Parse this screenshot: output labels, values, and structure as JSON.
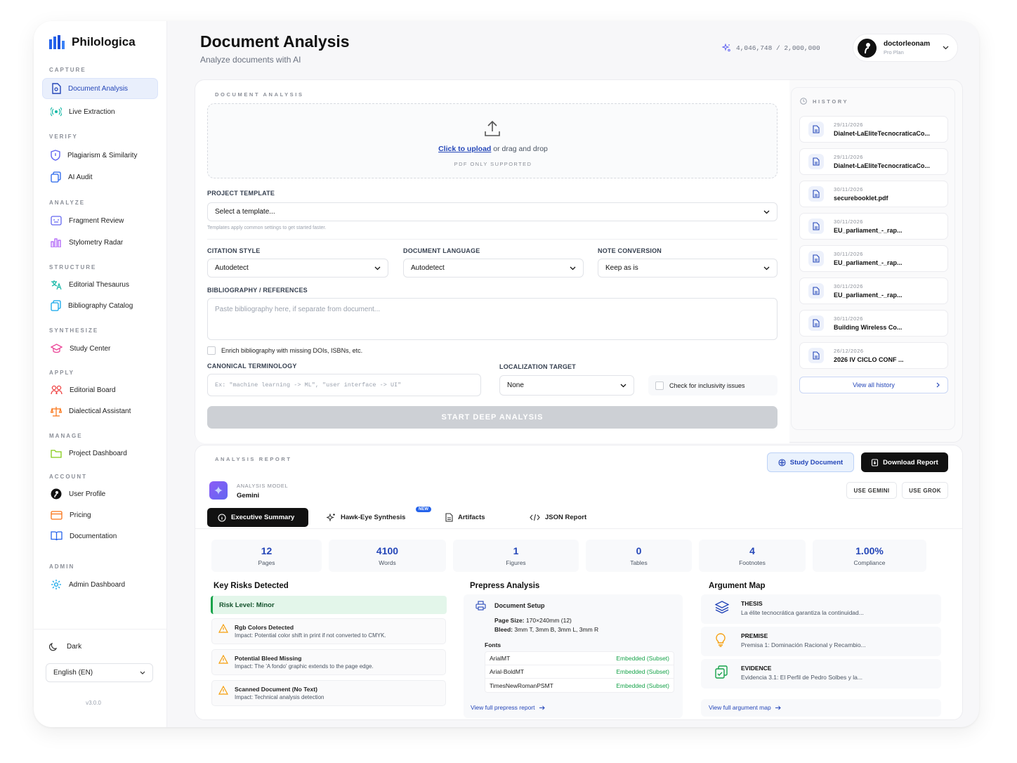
{
  "app": {
    "name": "Philologica",
    "version": "v3.0.0"
  },
  "sidebar": {
    "sections": [
      "CAPTURE",
      "VERIFY",
      "ANALYZE",
      "STRUCTURE",
      "SYNTHESIZE",
      "APPLY",
      "MANAGE",
      "ACCOUNT",
      "ADMIN"
    ],
    "items": [
      {
        "label": "Document Analysis",
        "icon": "document-icon"
      },
      {
        "label": "Live Extraction",
        "icon": "signal-icon"
      },
      {
        "label": "Plagiarism & Similarity",
        "icon": "shield-icon"
      },
      {
        "label": "AI Audit",
        "icon": "copy-icon"
      },
      {
        "label": "Fragment Review",
        "icon": "review-icon"
      },
      {
        "label": "Stylometry Radar",
        "icon": "bar-chart-icon"
      },
      {
        "label": "Editorial Thesaurus",
        "icon": "translate-icon"
      },
      {
        "label": "Bibliography Catalog",
        "icon": "catalog-icon"
      },
      {
        "label": "Study Center",
        "icon": "graduation-icon"
      },
      {
        "label": "Editorial Board",
        "icon": "users-icon"
      },
      {
        "label": "Dialectical Assistant",
        "icon": "scale-icon"
      },
      {
        "label": "Project Dashboard",
        "icon": "folder-icon"
      },
      {
        "label": "User Profile",
        "icon": "avatar-icon"
      },
      {
        "label": "Pricing",
        "icon": "card-icon"
      },
      {
        "label": "Documentation",
        "icon": "book-icon"
      },
      {
        "label": "Admin Dashboard",
        "icon": "gear-icon"
      }
    ],
    "theme_label": "Dark",
    "language": "English (EN)"
  },
  "header": {
    "title": "Document Analysis",
    "subtitle": "Analyze documents with AI",
    "tokens": "4,046,748 / 2,000,000",
    "user": {
      "name": "doctorleonam",
      "plan": "Pro Plan"
    }
  },
  "form": {
    "caption": "DOCUMENT ANALYSIS",
    "upload_link": "Click to upload",
    "upload_rest": " or drag and drop",
    "upload_hint": "PDF ONLY SUPPORTED",
    "template_label": "PROJECT TEMPLATE",
    "template_value": "Select a template...",
    "template_hint": "Templates apply common settings to get started faster.",
    "citation_label": "CITATION STYLE",
    "citation_value": "Autodetect",
    "language_label": "DOCUMENT LANGUAGE",
    "language_value": "Autodetect",
    "note_label": "NOTE CONVERSION",
    "note_value": "Keep as is",
    "biblio_label": "BIBLIOGRAPHY / REFERENCES",
    "biblio_placeholder": "Paste bibliography here, if separate from document...",
    "enrich_label": "Enrich bibliography with missing DOIs, ISBNs, etc.",
    "terminology_label": "CANONICAL TERMINOLOGY",
    "terminology_placeholder": "Ex: \"machine learning -> ML\", \"user interface -> UI\"",
    "localization_label": "LOCALIZATION TARGET",
    "localization_value": "None",
    "inclusivity_label": "Check for inclusivity issues",
    "start_label": "START DEEP ANALYSIS"
  },
  "history": {
    "caption": "HISTORY",
    "items": [
      {
        "date": "29/11/2026",
        "name": "Dialnet-LaEliteTecnocraticaCo..."
      },
      {
        "date": "29/11/2026",
        "name": "Dialnet-LaEliteTecnocraticaCo..."
      },
      {
        "date": "30/11/2026",
        "name": "securebooklet.pdf"
      },
      {
        "date": "30/11/2026",
        "name": "EU_parliament_-_rap..."
      },
      {
        "date": "30/11/2026",
        "name": "EU_parliament_-_rap..."
      },
      {
        "date": "30/11/2026",
        "name": "EU_parliament_-_rap..."
      },
      {
        "date": "30/11/2026",
        "name": "Building Wireless Co..."
      },
      {
        "date": "26/12/2026",
        "name": "2026 IV CICLO CONF ..."
      }
    ],
    "view_all": "View all history"
  },
  "report": {
    "caption": "ANALYSIS REPORT",
    "study_btn": "Study Document",
    "download_btn": "Download Report",
    "model_label": "ANALYSIS MODEL",
    "model_value": "Gemini",
    "use_gemini": "USE GEMINI",
    "use_grok": "USE GROK",
    "tabs": [
      "Executive Summary",
      "Hawk-Eye Synthesis",
      "Artifacts",
      "JSON Report"
    ],
    "new_badge": "NEW",
    "stats": [
      {
        "value": "12",
        "label": "Pages"
      },
      {
        "value": "4100",
        "label": "Words"
      },
      {
        "value": "1",
        "label": "Figures"
      },
      {
        "value": "0",
        "label": "Tables"
      },
      {
        "value": "4",
        "label": "Footnotes"
      },
      {
        "value": "1.00%",
        "label": "Compliance"
      }
    ],
    "risks": {
      "title": "Key Risks Detected",
      "level": "Risk Level: Minor",
      "items": [
        {
          "title": "Rgb Colors Detected",
          "desc": "Impact: Potential color shift in print if not converted to CMYK."
        },
        {
          "title": "Potential Bleed Missing",
          "desc": "Impact: The 'A fondo' graphic extends to the page edge."
        },
        {
          "title": "Scanned Document (No Text)",
          "desc": "Impact: Technical analysis detection"
        }
      ]
    },
    "prepress": {
      "title": "Prepress Analysis",
      "setup": "Document Setup",
      "page_size_label": "Page Size:",
      "page_size": "170×240mm (12)",
      "bleed_label": "Bleed:",
      "bleed": "3mm T, 3mm B, 3mm L, 3mm R",
      "fonts_label": "Fonts",
      "fonts": [
        {
          "name": "ArialMT",
          "status": "Embedded (Subset)"
        },
        {
          "name": "Arial-BoldMT",
          "status": "Embedded (Subset)"
        },
        {
          "name": "TimesNewRomanPSMT",
          "status": "Embedded (Subset)"
        }
      ],
      "link": "View full prepress report"
    },
    "argument": {
      "title": "Argument Map",
      "items": [
        {
          "type": "THESIS",
          "text": "La élite tecnocrática garantiza la continuidad..."
        },
        {
          "type": "PREMISE",
          "text": "Premisa 1: Dominación Racional y Recambio..."
        },
        {
          "type": "EVIDENCE",
          "text": "Evidencia 3.1: El Perfil de Pedro Solbes y la..."
        }
      ],
      "link": "View full argument map"
    }
  },
  "colors": {
    "accent": "#2446b8",
    "success": "#16a34a",
    "warning": "#f59e0b"
  }
}
